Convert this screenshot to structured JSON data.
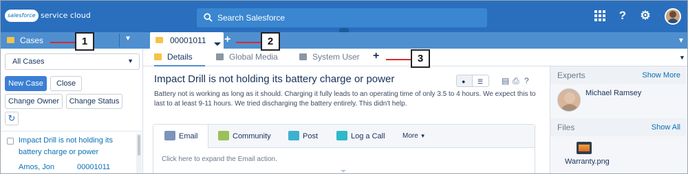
{
  "header": {
    "logo_text": "salesforce",
    "app_name": "service cloud",
    "search_placeholder": "Search Salesforce",
    "icons": [
      "app-launcher-icon",
      "help-icon",
      "gear-icon",
      "avatar"
    ]
  },
  "left_pane": {
    "tab_label": "Cases",
    "list_view": "All Cases",
    "buttons": {
      "new_case": "New Case",
      "close": "Close",
      "change_owner": "Change Owner",
      "change_status": "Change Status"
    },
    "record": {
      "subject": "Impact Drill is not holding its battery charge or power",
      "owner": "Amos, Jon",
      "number": "00001011"
    }
  },
  "tabs": {
    "record_tab": "00001011",
    "subtabs": [
      "Details",
      "Global Media",
      "System User"
    ]
  },
  "case": {
    "title": "Impact Drill is not holding its battery charge or power",
    "description": "Battery not is working as long as it should. Charging it fully leads to an operating time of only 3.5 to 4 hours. We expect this to last to at least 9-11 hours. We tried discharging the battery entirely. This didn't help."
  },
  "publisher": {
    "tabs": [
      "Email",
      "Community",
      "Post",
      "Log a Call"
    ],
    "more": "More",
    "expand_text": "Click here to expand the Email action."
  },
  "sidebar": {
    "experts_title": "Experts",
    "experts_link": "Show More",
    "expert_name": "Michael Ramsey",
    "files_title": "Files",
    "files_link": "Show All",
    "file_name": "Warranty.png"
  },
  "callouts": [
    "1",
    "2",
    "3"
  ],
  "colors": {
    "header": "#2a6fbe",
    "tab_strip": "#4f8fcf",
    "primary_button": "#3b7fd4",
    "link": "#0a6fb5",
    "callout_line": "#d62c2c"
  }
}
